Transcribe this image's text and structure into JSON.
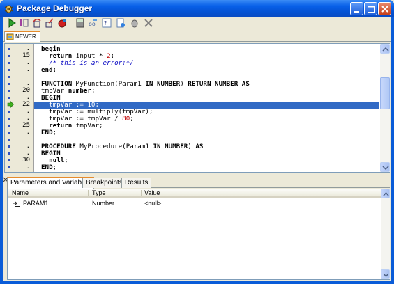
{
  "window": {
    "title": "Package Debugger",
    "controls": [
      "minimize",
      "maximize",
      "close"
    ]
  },
  "toolbar": {
    "tools": [
      "run-icon",
      "step-into-icon",
      "step-over-icon",
      "step-out-icon",
      "breakpoint-icon",
      "calculator-icon",
      "watch-icon",
      "evaluate-icon",
      "compile-icon",
      "debug-icon",
      "stop-icon"
    ]
  },
  "editor_tab": {
    "label": "NEWER"
  },
  "gutter": [
    {
      "num": "."
    },
    {
      "num": "15"
    },
    {
      "num": "."
    },
    {
      "num": "."
    },
    {
      "num": ""
    },
    {
      "num": "."
    },
    {
      "num": "20"
    },
    {
      "num": "."
    },
    {
      "num": "22"
    },
    {
      "num": "."
    },
    {
      "num": "."
    },
    {
      "num": "25"
    },
    {
      "num": "."
    },
    {
      "num": ""
    },
    {
      "num": "."
    },
    {
      "num": "."
    },
    {
      "num": "30"
    },
    {
      "num": "."
    }
  ],
  "code_lines": [
    "begin",
    "  return input * 2;",
    "  /* this is an error;*/",
    "end;",
    "",
    "FUNCTION MyFunction(Param1 IN NUMBER) RETURN NUMBER AS",
    "tmpVar number;",
    "BEGIN",
    "  tmpVar := 10;",
    "  tmpVar := multiply(tmpVar);",
    "  tmpVar := tmpVar / 80;",
    "  return tmpVar;",
    "END;",
    "",
    "PROCEDURE MyProcedure(Param1 IN NUMBER) AS",
    "BEGIN",
    "  null;",
    "END;"
  ],
  "current_line": "22",
  "bottom_tabs": [
    "Parameters and Variables",
    "Breakpoints",
    "Results"
  ],
  "grid": {
    "columns": [
      "Name",
      "Type",
      "Value"
    ],
    "rows": [
      {
        "name": "PARAM1",
        "type": "Number",
        "value": "<null>"
      }
    ]
  },
  "colors": {
    "titlebar": "#0a5cd8",
    "selection": "#316ac5",
    "tab_accent": "#e68b2c"
  }
}
